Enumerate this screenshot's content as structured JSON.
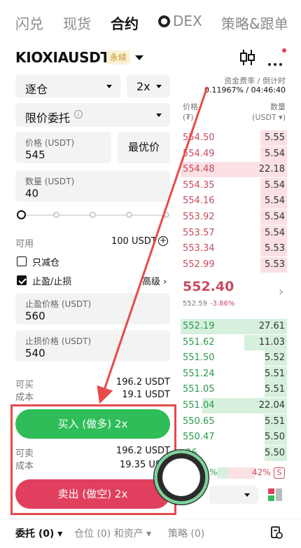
{
  "nav": {
    "items": [
      "闪兑",
      "现货",
      "合约",
      "DEX",
      "策略&跟单"
    ],
    "active_index": 2
  },
  "header": {
    "symbol": "KIOXIAUSDT",
    "badge": "永续"
  },
  "funding": {
    "label": "资金费率 / 倒计时",
    "value": "0.11967% / 04:46:40"
  },
  "controls": {
    "margin_mode": "逐仓",
    "leverage": "2x",
    "order_type": "限价委托",
    "price_label": "价格 (USDT)",
    "price_value": "545",
    "best_price": "最优价",
    "qty_label": "数量 (USDT)",
    "qty_value": "40",
    "available_label": "可用",
    "available_value": "100 USDT",
    "reduce_only": "只减仓",
    "tpsl": "止盈/止损",
    "advanced": "高级",
    "tp_label": "止盈价格 (USDT)",
    "tp_value": "560",
    "sl_label": "止损价格 (USDT)",
    "sl_value": "540",
    "can_buy_label": "可买",
    "can_buy_value": "196.2 USDT",
    "cost1_label": "成本",
    "cost1_value": "19.1 USDT",
    "buy_label": "买入 (做多) 2x",
    "can_sell_label": "可卖",
    "can_sell_value": "196.2 USDT",
    "cost2_label": "成本",
    "cost2_value": "19.35 US",
    "sell_label": "卖出 (做空) 2x"
  },
  "orderbook": {
    "price_header": "价格",
    "price_unit": "(₮)",
    "qty_header": "数量",
    "qty_unit": "(USDT ▾)",
    "asks": [
      {
        "price": "554.50",
        "qty": "5.55"
      },
      {
        "price": "554.49",
        "qty": "5.54"
      },
      {
        "price": "554.48",
        "qty": "22.18"
      },
      {
        "price": "554.35",
        "qty": "5.54"
      },
      {
        "price": "554.16",
        "qty": "5.54"
      },
      {
        "price": "553.92",
        "qty": "5.54"
      },
      {
        "price": "553.57",
        "qty": "5.54"
      },
      {
        "price": "553.34",
        "qty": "5.53"
      },
      {
        "price": "552.99",
        "qty": "5.53"
      }
    ],
    "last_price": "552.40",
    "mark_price": "552.59",
    "change": "-3.86%",
    "bids": [
      {
        "price": "552.19",
        "qty": "27.61"
      },
      {
        "price": "551.62",
        "qty": "11.03"
      },
      {
        "price": "551.50",
        "qty": "5.52"
      },
      {
        "price": "551.24",
        "qty": "5.51"
      },
      {
        "price": "551.05",
        "qty": "5.51"
      },
      {
        "price": "551.04",
        "qty": "22.04"
      },
      {
        "price": "550.65",
        "qty": "5.51"
      },
      {
        "price": "550.47",
        "qty": "5.50"
      },
      {
        "price": ".26",
        "qty": "5.50"
      }
    ],
    "ratio_buy": "%",
    "ratio_sell": "42%",
    "ratio_sell_badge": "S"
  },
  "bottom": {
    "orders": "委托 (0)",
    "positions": "仓位 (0) 和资产",
    "strategies": "策略 (0)"
  },
  "colors": {
    "buy": "#2ebd59",
    "sell": "#e0405e",
    "annotation": "#e84a4a"
  }
}
